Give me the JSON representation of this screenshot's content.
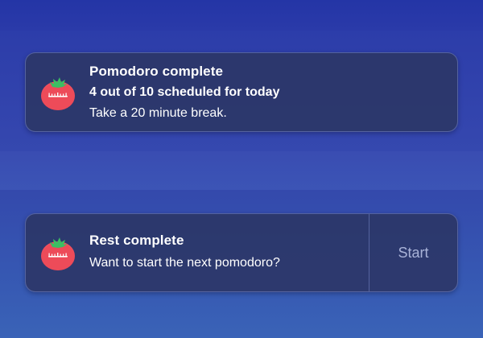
{
  "notifications": [
    {
      "app_icon": "tomato-timer-icon",
      "title": "Pomodoro complete",
      "line1": "4 out of 10 scheduled for today",
      "line2": "Take a 20 minute break."
    },
    {
      "app_icon": "tomato-timer-icon",
      "title": "Rest complete",
      "body": "Want to start the next pomodoro?",
      "action_label": "Start"
    }
  ],
  "colors": {
    "tomato_red": "#f0505e",
    "tomato_leaf": "#3bbf63",
    "toast_bg": "#2c3768",
    "action_text": "#a9b3d8"
  }
}
